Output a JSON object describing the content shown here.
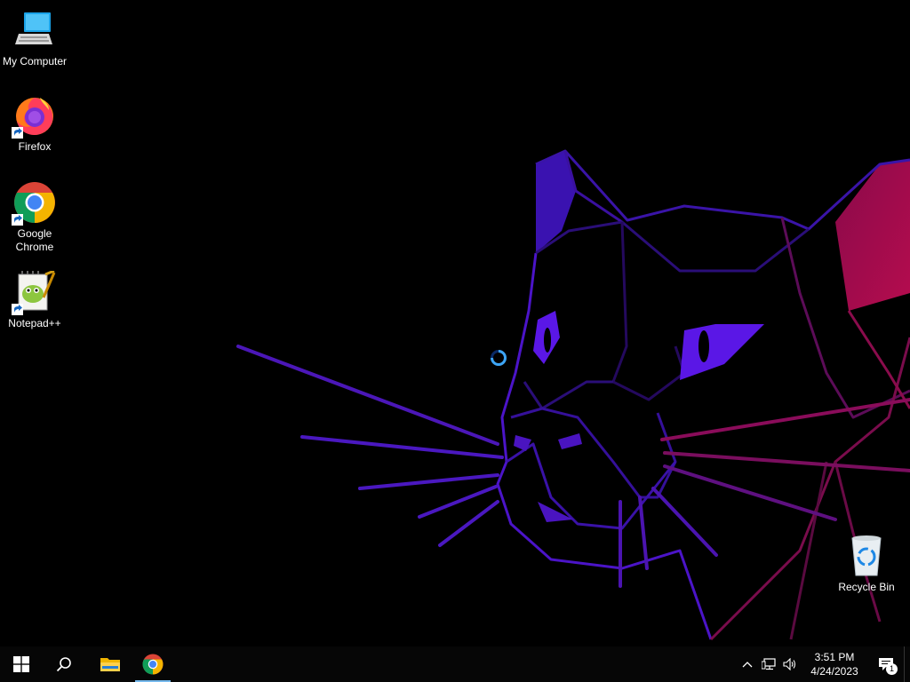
{
  "desktop": {
    "icons": [
      {
        "name": "my-computer",
        "label": "My Computer",
        "icon": "computer-icon"
      },
      {
        "name": "firefox",
        "label": "Firefox",
        "icon": "firefox-icon",
        "shortcut": true
      },
      {
        "name": "google-chrome",
        "label": "Google Chrome",
        "icon": "chrome-icon",
        "shortcut": true
      },
      {
        "name": "notepad-plus-plus",
        "label": "Notepad++",
        "icon": "notepadpp-icon",
        "shortcut": true
      },
      {
        "name": "recycle-bin",
        "label": "Recycle Bin",
        "icon": "recycle-bin-icon"
      }
    ],
    "wallpaper": "geometric-panther",
    "cursor": "busy-cursor-icon"
  },
  "taskbar": {
    "buttons": [
      {
        "name": "start-button",
        "icon": "windows-logo-icon"
      },
      {
        "name": "search-button",
        "icon": "search-icon"
      },
      {
        "name": "file-explorer-button",
        "icon": "folder-icon"
      },
      {
        "name": "chrome-taskbar-button",
        "icon": "chrome-icon",
        "active": true
      }
    ],
    "tray": {
      "icons": [
        "chevron-up-icon",
        "network-icon",
        "volume-icon"
      ],
      "time": "3:51 PM",
      "date": "4/24/2023",
      "notification_count": "1"
    }
  },
  "colors": {
    "background": "#000000",
    "accent_purple": "#5a17e6",
    "accent_magenta": "#c4105e",
    "taskbar": "#060606"
  }
}
